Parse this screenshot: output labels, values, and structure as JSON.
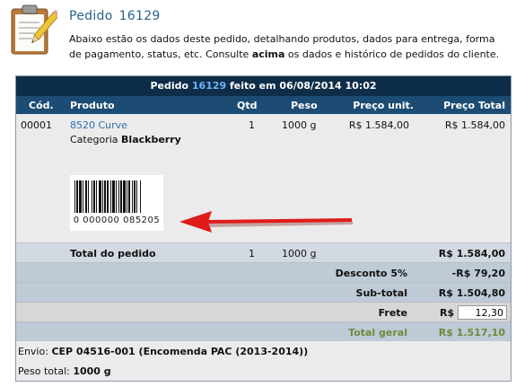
{
  "header": {
    "title": "Pedido",
    "order_number": "16129",
    "intro_before": "Abaixo estão os dados deste pedido, detalhando produtos, dados para entrega, forma de pagamento, status, etc. Consulte ",
    "intro_bold": "acima",
    "intro_after": " os dados e histórico de pedidos do cliente."
  },
  "order": {
    "header_prefix": "Pedido",
    "number": "16129",
    "header_suffix": "feito em 06/08/2014 10:02",
    "columns": {
      "cod": "Cód.",
      "produto": "Produto",
      "qtd": "Qtd",
      "peso": "Peso",
      "preco_unit": "Preço unit.",
      "preco_total": "Preço Total"
    },
    "items": [
      {
        "cod": "00001",
        "name": "8520 Curve",
        "category_label": "Categoria",
        "category": "Blackberry",
        "qtd": "1",
        "peso": "1000 g",
        "preco_unit": "R$ 1.584,00",
        "preco_total": "R$ 1.584,00",
        "barcode_number": "0 000000 085205"
      }
    ],
    "total": {
      "label": "Total do pedido",
      "qtd": "1",
      "peso": "1000 g",
      "value": "R$ 1.584,00"
    },
    "desconto": {
      "label": "Desconto 5%",
      "value": "-R$ 79,20"
    },
    "subtotal": {
      "label": "Sub-total",
      "value": "R$ 1.504,80"
    },
    "frete": {
      "label": "Frete",
      "currency": "R$",
      "value": "12,30"
    },
    "geral": {
      "label": "Total geral",
      "value": "R$ 1.517,10"
    },
    "envio": {
      "label": "Envio:",
      "value": "CEP 04516-001 (Encomenda PAC (2013-2014))"
    },
    "peso_total": {
      "label": "Peso total:",
      "value": "1000 g"
    }
  },
  "colors": {
    "header_bg": "#0e2d48",
    "column_header_bg": "#1c4c74",
    "link": "#2f6fb3",
    "total_geral": "#6d8b3c",
    "arrow": "#e01b1b"
  },
  "icons": {
    "page_icon": "clipboard-pencil-icon",
    "annotation": "red-arrow-icon"
  }
}
